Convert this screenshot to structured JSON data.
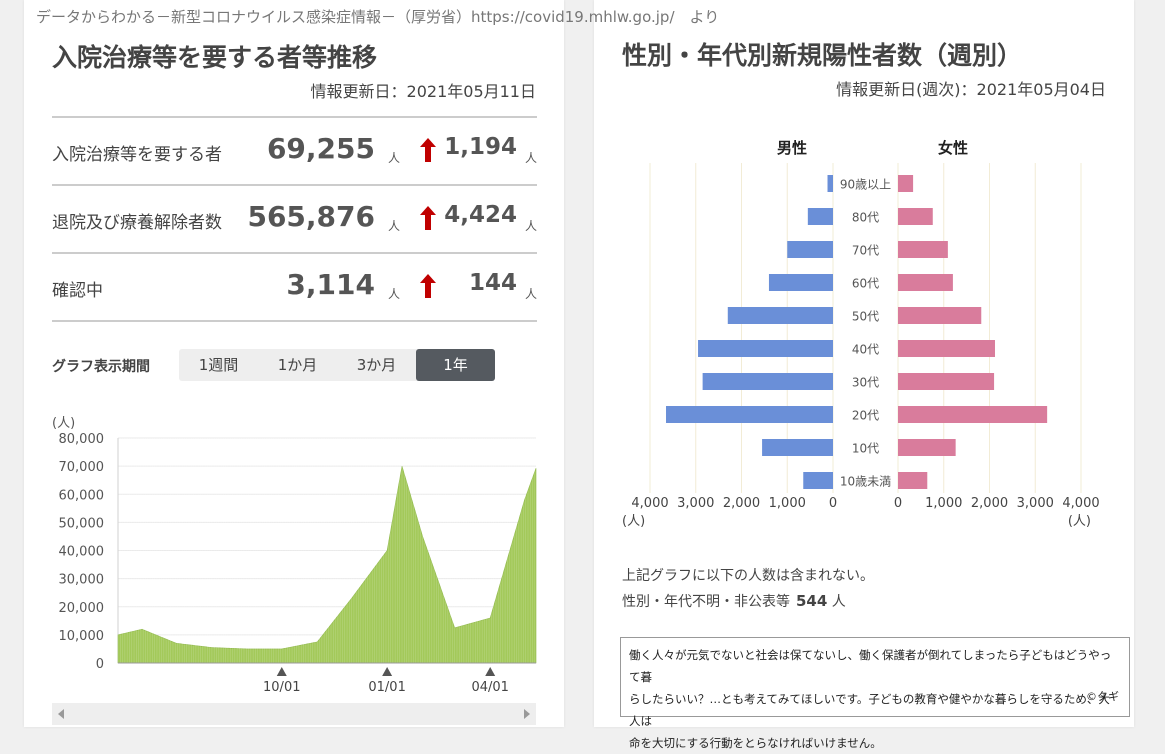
{
  "source": "データからわかる－新型コロナウイルス感染症情報－（厚労省）https://covid19.mhlw.go.jp/　より",
  "left": {
    "title": "入院治療等を要する者等推移",
    "updated": "情報更新日：2021年05月11日",
    "rows": [
      {
        "label": "入院治療等を要する者",
        "value": "69,255",
        "unit": "人",
        "increase": "1,194",
        "inc_unit": "人"
      },
      {
        "label": "退院及び療養解除者数",
        "value": "565,876",
        "unit": "人",
        "increase": "4,424",
        "inc_unit": "人"
      },
      {
        "label": "確認中",
        "value": "3,114",
        "unit": "人",
        "increase": "144",
        "inc_unit": "人"
      }
    ],
    "arrow_color": "#c00000",
    "period_label": "グラフ表示期間",
    "period_buttons": [
      "1週間",
      "1か月",
      "3か月",
      "1年"
    ],
    "period_selected": "1年"
  },
  "right": {
    "title": "性別・年代別新規陽性者数（週別）",
    "updated": "情報更新日(週次)：2021年05月04日",
    "note1": "上記グラフに以下の人数は含まれない。",
    "note2_label": "性別・年代不明・非公表等",
    "note2_value": "544",
    "note2_unit": "人"
  },
  "comment": {
    "line1": "働く人々が元気でないと社会は保てないし、働く保護者が倒れてしまったら子どもはどうやって暮",
    "line2": "らしたらいい？…とも考えてみてほしいです。子どもの教育や健やかな暮らしを守るため、大人は",
    "line3": "命を大切にする行動をとらなければいけません。",
    "signature": "©タギ"
  },
  "chart_data": [
    {
      "type": "bar",
      "ylabel": "(人)",
      "ylim": [
        0,
        80000
      ],
      "yticks": [
        "80,000",
        "70,000",
        "60,000",
        "50,000",
        "40,000",
        "30,000",
        "20,000",
        "10,000",
        "0"
      ],
      "xticks": [
        "10/01",
        "01/01",
        "04/01"
      ],
      "color": "#a3c95a",
      "x": [
        "2020-05-11",
        "2020-06-01",
        "2020-07-01",
        "2020-08-01",
        "2020-09-01",
        "2020-10-01",
        "2020-11-01",
        "2020-12-01",
        "2021-01-01",
        "2021-01-14",
        "2021-02-01",
        "2021-03-01",
        "2021-04-01",
        "2021-05-01",
        "2021-05-11"
      ],
      "values": [
        10000,
        12000,
        7000,
        5500,
        5000,
        5000,
        7500,
        23000,
        40000,
        70000,
        45000,
        12500,
        16000,
        58000,
        69255
      ]
    },
    {
      "type": "bar",
      "orientation": "horizontal",
      "categories": [
        "90歳以上",
        "80代",
        "70代",
        "60代",
        "50代",
        "40代",
        "30代",
        "20代",
        "10代",
        "10歳未満"
      ],
      "series": [
        {
          "name": "男性",
          "color": "#6a8fd8",
          "values": [
            120,
            550,
            1000,
            1400,
            2300,
            2950,
            2850,
            3650,
            1550,
            650
          ]
        },
        {
          "name": "女性",
          "color": "#d97c9c",
          "values": [
            330,
            760,
            1090,
            1200,
            1820,
            2120,
            2100,
            3260,
            1260,
            640
          ]
        }
      ],
      "xticks_left": [
        "4,000",
        "3,000",
        "2,000",
        "1,000",
        "0"
      ],
      "xticks_right": [
        "0",
        "1,000",
        "2,000",
        "3,000",
        "4,000"
      ],
      "xlim": [
        0,
        4000
      ],
      "unit_label": "(人)"
    }
  ]
}
